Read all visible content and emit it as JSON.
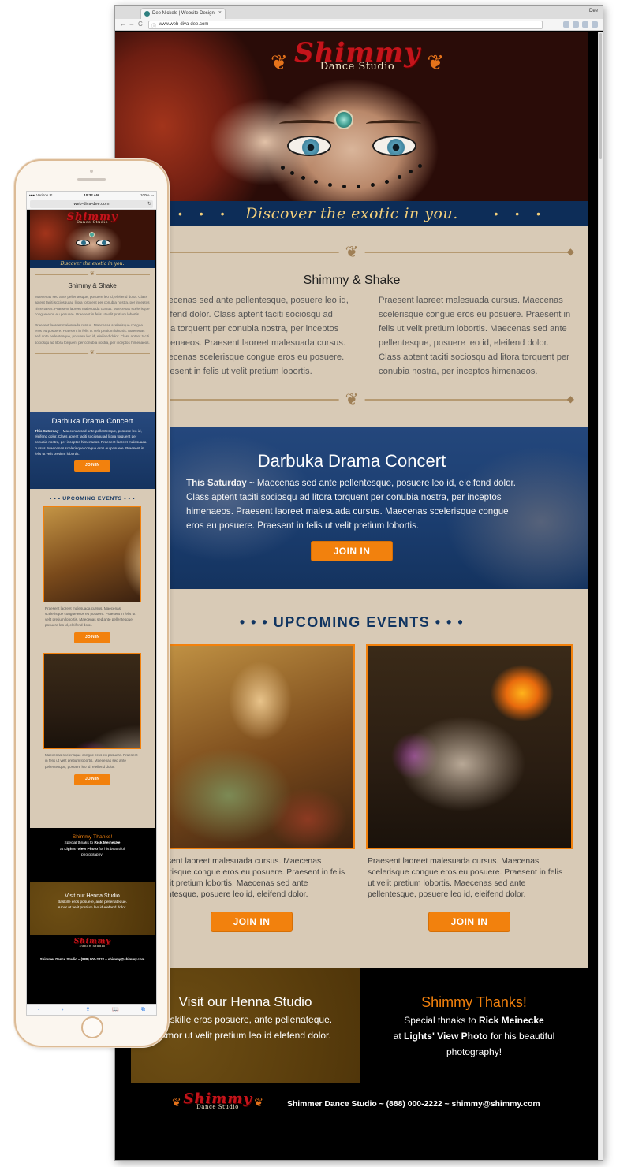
{
  "browser": {
    "tab_title": "Dee Nickels | Website Design",
    "tab_close": "×",
    "user_name": "Dee",
    "url": "www.web-diva-dee.com",
    "back_icon": "←",
    "forward_icon": "→",
    "reload_icon": "C"
  },
  "brand": {
    "logo_script": "Shimmy",
    "logo_sub": "Dance Studio",
    "ornament": "❦",
    "accent_orange": "#f2810d",
    "navy": "#0d2d58",
    "sand": "#d8cab6"
  },
  "hero": {
    "tagline": "Discover the exotic in you.",
    "tagline_dots": "• • •"
  },
  "intro": {
    "heading": "Shimmy & Shake",
    "divider_ornament": "❦",
    "col_left": "Maecenas sed ante pellentesque, posuere leo id, eleifend dolor. Class aptent taciti sociosqu ad litora torquent per conubia nostra, per inceptos himenaeos. Praesent laoreet malesuada cursus. Maecenas scelerisque congue eros eu posuere. Praesent in felis ut velit pretium lobortis.",
    "col_right": "Praesent laoreet malesuada cursus. Maecenas scelerisque congue eros eu posuere. Praesent in felis ut velit pretium lobortis. Maecenas sed ante pellentesque, posuere leo id, eleifend dolor. Class aptent taciti sociosqu ad litora torquent per conubia nostra, per inceptos himenaeos."
  },
  "concert": {
    "title": "Darbuka Drama Concert",
    "lead": "This Saturday",
    "body": " ~ Maecenas sed ante pellentesque, posuere leo id, eleifend dolor. Class aptent taciti sociosqu ad litora torquent per conubia nostra, per inceptos himenaeos. Praesent laoreet malesuada cursus. Maecenas scelerisque congue eros eu posuere. Praesent in felis ut velit pretium lobortis.",
    "button": "JOIN IN"
  },
  "events": {
    "title": "• • • UPCOMING EVENTS • • •",
    "items": [
      {
        "text": "Praesent laoreet malesuada cursus. Maecenas scelerisque congue eros eu posuere. Praesent in felis ut velit pretium lobortis. Maecenas sed ante pellentesque, posuere leo id, eleifend dolor.",
        "button": "JOIN IN"
      },
      {
        "text": "Praesent laoreet malesuada cursus. Maecenas scelerisque congue eros eu posuere. Praesent in felis ut velit pretium lobortis. Maecenas sed ante pellentesque, posuere leo id, eleifend dolor.",
        "button": "JOIN IN"
      }
    ]
  },
  "henna": {
    "title": "Visit our Henna Studio",
    "line1": "Baskille eros posuere, ante pellenateque.",
    "line2": "Amor ut velit pretium leo id elefend dolor."
  },
  "thanks": {
    "title": "Shimmy Thanks!",
    "line1_prefix": "Special thnaks to ",
    "line1_name": "Rick Meinecke",
    "line2_prefix": "at ",
    "line2_name": "Lights' View Photo",
    "line2_suffix": " for his beautiful",
    "line3": "photography!"
  },
  "footer": {
    "contact": "Shimmer Dance Studio  ~  (888) 000-2222  ~  shimmy@shimmy.com"
  },
  "mobile": {
    "carrier": "••••• Verizon ᯤ",
    "time": "10:32 AM",
    "battery": "100% ▭",
    "url": "web-diva-dee.com",
    "reload_icon": "↻",
    "intro_p1": "Maecenas sed ante pellentesque, posuere leo id, eleifend dolor. Class aptent taciti sociosqu ad litora torquent per conubia nostra, per inceptos himenaeos. Praesent laoreet malesuada cursus. Maecenas scelerisque congue eros eu posuere. Praesent in felis ut velit pretium lobortis.",
    "intro_p2": "Praesent laoreet malesuada cursus. Maecenas scelerisque congue eros eu posuere. Praesent in felis ut velit pretium lobortis. Maecenas sed ante pellentesque, posuere leo id, eleifend dolor. Class aptent taciti sociosqu ad litora torquent per conubia nostra, per inceptos himenaeos.",
    "event1_text": "Praesent laoreet malesuada cursus. Maecenas scelerisque congue eros eu posuere. Praesent in felis ut velit pretium lobortis. Maecenas sed ante pellentesque, posuere leo id, eleifend dolor.",
    "event2_text": "Maecenas scelerisque congue eros eu posuere. Praesent in felis ut velit pretium lobortis. Maecenas sed ante pellentesque, posuere leo id, eleifend dolor.",
    "footer_contact": "Shimmer Dance Studio  ~  (888) 000-2222  ~  shimmy@shimmy.com",
    "toolbar": {
      "back": "‹",
      "forward": "›",
      "share": "⇪",
      "bookmarks": "📖",
      "tabs": "⧉"
    }
  }
}
